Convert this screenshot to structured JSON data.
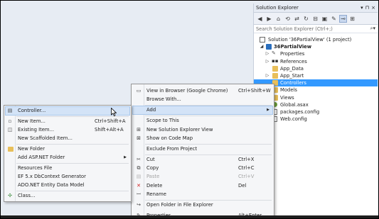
{
  "solution_explorer": {
    "title": "Solution Explorer",
    "title_buttons": [
      "▾",
      "⊓",
      "×"
    ],
    "search_placeholder": "Search Solution Explorer (Ctrl+;)",
    "tree": {
      "solution": "Solution '36PartialView' (1 project)",
      "project": "36PartialView",
      "items": [
        "Properties",
        "References",
        "App_Data",
        "App_Start",
        "Controllers",
        "Models",
        "Views",
        "Global.asax",
        "packages.config",
        "Web.config"
      ]
    }
  },
  "context_menu": {
    "items": [
      {
        "label": "View in Browser (Google Chrome)",
        "shortcut": "Ctrl+Shift+W"
      },
      {
        "label": "Browse With..."
      },
      {
        "label": "Add"
      },
      {
        "label": "Scope to This"
      },
      {
        "label": "New Solution Explorer View"
      },
      {
        "label": "Show on Code Map"
      },
      {
        "label": "Exclude From Project"
      },
      {
        "label": "Cut",
        "shortcut": "Ctrl+X"
      },
      {
        "label": "Copy",
        "shortcut": "Ctrl+C"
      },
      {
        "label": "Paste",
        "shortcut": "Ctrl+V"
      },
      {
        "label": "Delete",
        "shortcut": "Del"
      },
      {
        "label": "Rename"
      },
      {
        "label": "Open Folder in File Explorer"
      },
      {
        "label": "Properties",
        "shortcut": "Alt+Enter"
      }
    ]
  },
  "add_submenu": {
    "items": [
      {
        "label": "Controller..."
      },
      {
        "label": "New Item...",
        "shortcut": "Ctrl+Shift+A"
      },
      {
        "label": "Existing Item...",
        "shortcut": "Shift+Alt+A"
      },
      {
        "label": "New Scaffolded Item..."
      },
      {
        "label": "New Folder"
      },
      {
        "label": "Add ASP.NET Folder"
      },
      {
        "label": "Resources File"
      },
      {
        "label": "EF 5.x DbContext Generator"
      },
      {
        "label": "ADO.NET Entity Data Model"
      },
      {
        "label": "Class..."
      }
    ]
  },
  "colors": {
    "selection": "#3399ff",
    "menu_highlight": "#d3e3f7",
    "folder": "#e8bf5a"
  }
}
